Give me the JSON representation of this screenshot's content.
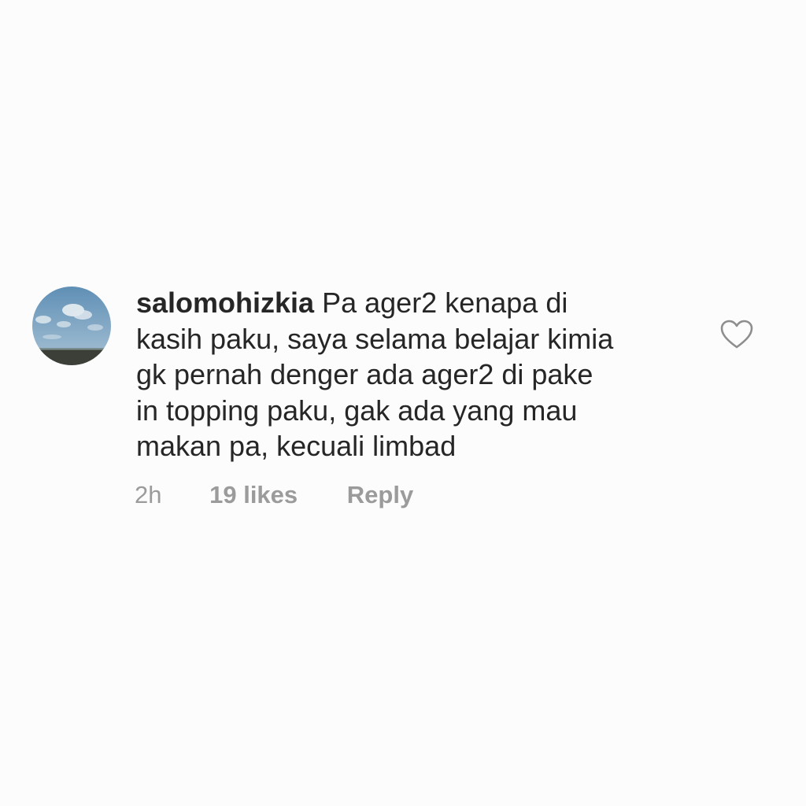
{
  "comment": {
    "username": "salomohizkia",
    "text_lines": [
      "Pa ager2 kenapa di",
      "kasih paku, saya selama belajar kimia",
      "gk pernah denger ada ager2 di pake",
      "in topping paku, gak ada yang mau",
      "makan pa, kecuali limbad"
    ],
    "time": "2h",
    "likes": "19 likes",
    "reply_label": "Reply"
  },
  "avatar": {
    "icon": "avatar-sky-photo",
    "colors": {
      "sky_top": "#5f8fb5",
      "sky_bottom": "#a9c3d6",
      "ground": "#3c3f38"
    }
  },
  "like_button": {
    "icon": "heart-outline-icon"
  },
  "colors": {
    "background": "#fcfcfc",
    "text": "#262626",
    "meta_text": "#9b9b9b"
  }
}
